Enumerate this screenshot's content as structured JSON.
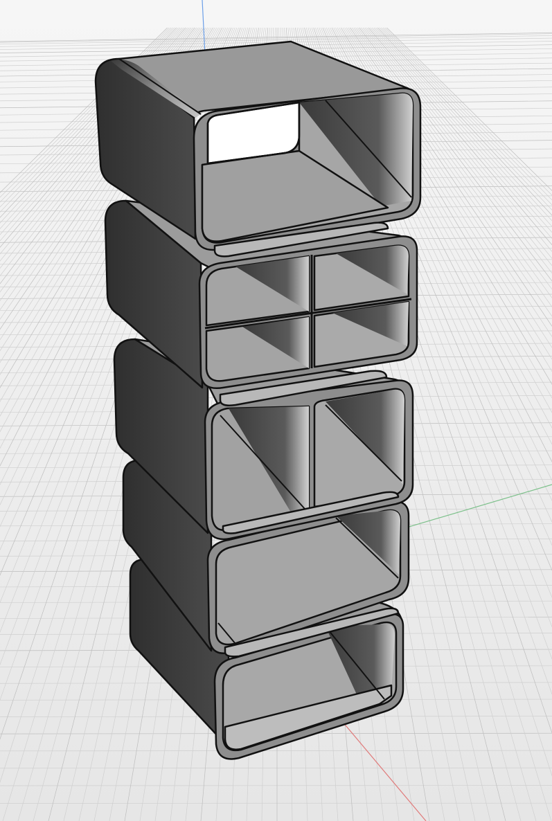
{
  "viewport": {
    "background_top": "#f4f4f4",
    "background_bottom": "#e8e8e8",
    "grid_color": "#cfcfcf",
    "grid_major_color": "#bdbdbd"
  },
  "axes": {
    "x_axis_color": "#e07a7a",
    "y_axis_color": "#7cc08a",
    "z_axis_color": "#6a9ee8"
  },
  "model": {
    "modules": [
      {
        "id": "module-1",
        "compartments": 1
      },
      {
        "id": "module-2",
        "compartments": 4
      },
      {
        "id": "module-3",
        "compartments": 2
      },
      {
        "id": "module-4",
        "compartments": 1
      },
      {
        "id": "module-5",
        "compartments": 1
      }
    ],
    "shade_dark": "#3b3b3b",
    "shade_mid": "#9a9a9a",
    "shade_light": "#b9b9b9",
    "edge_color": "#111111"
  }
}
